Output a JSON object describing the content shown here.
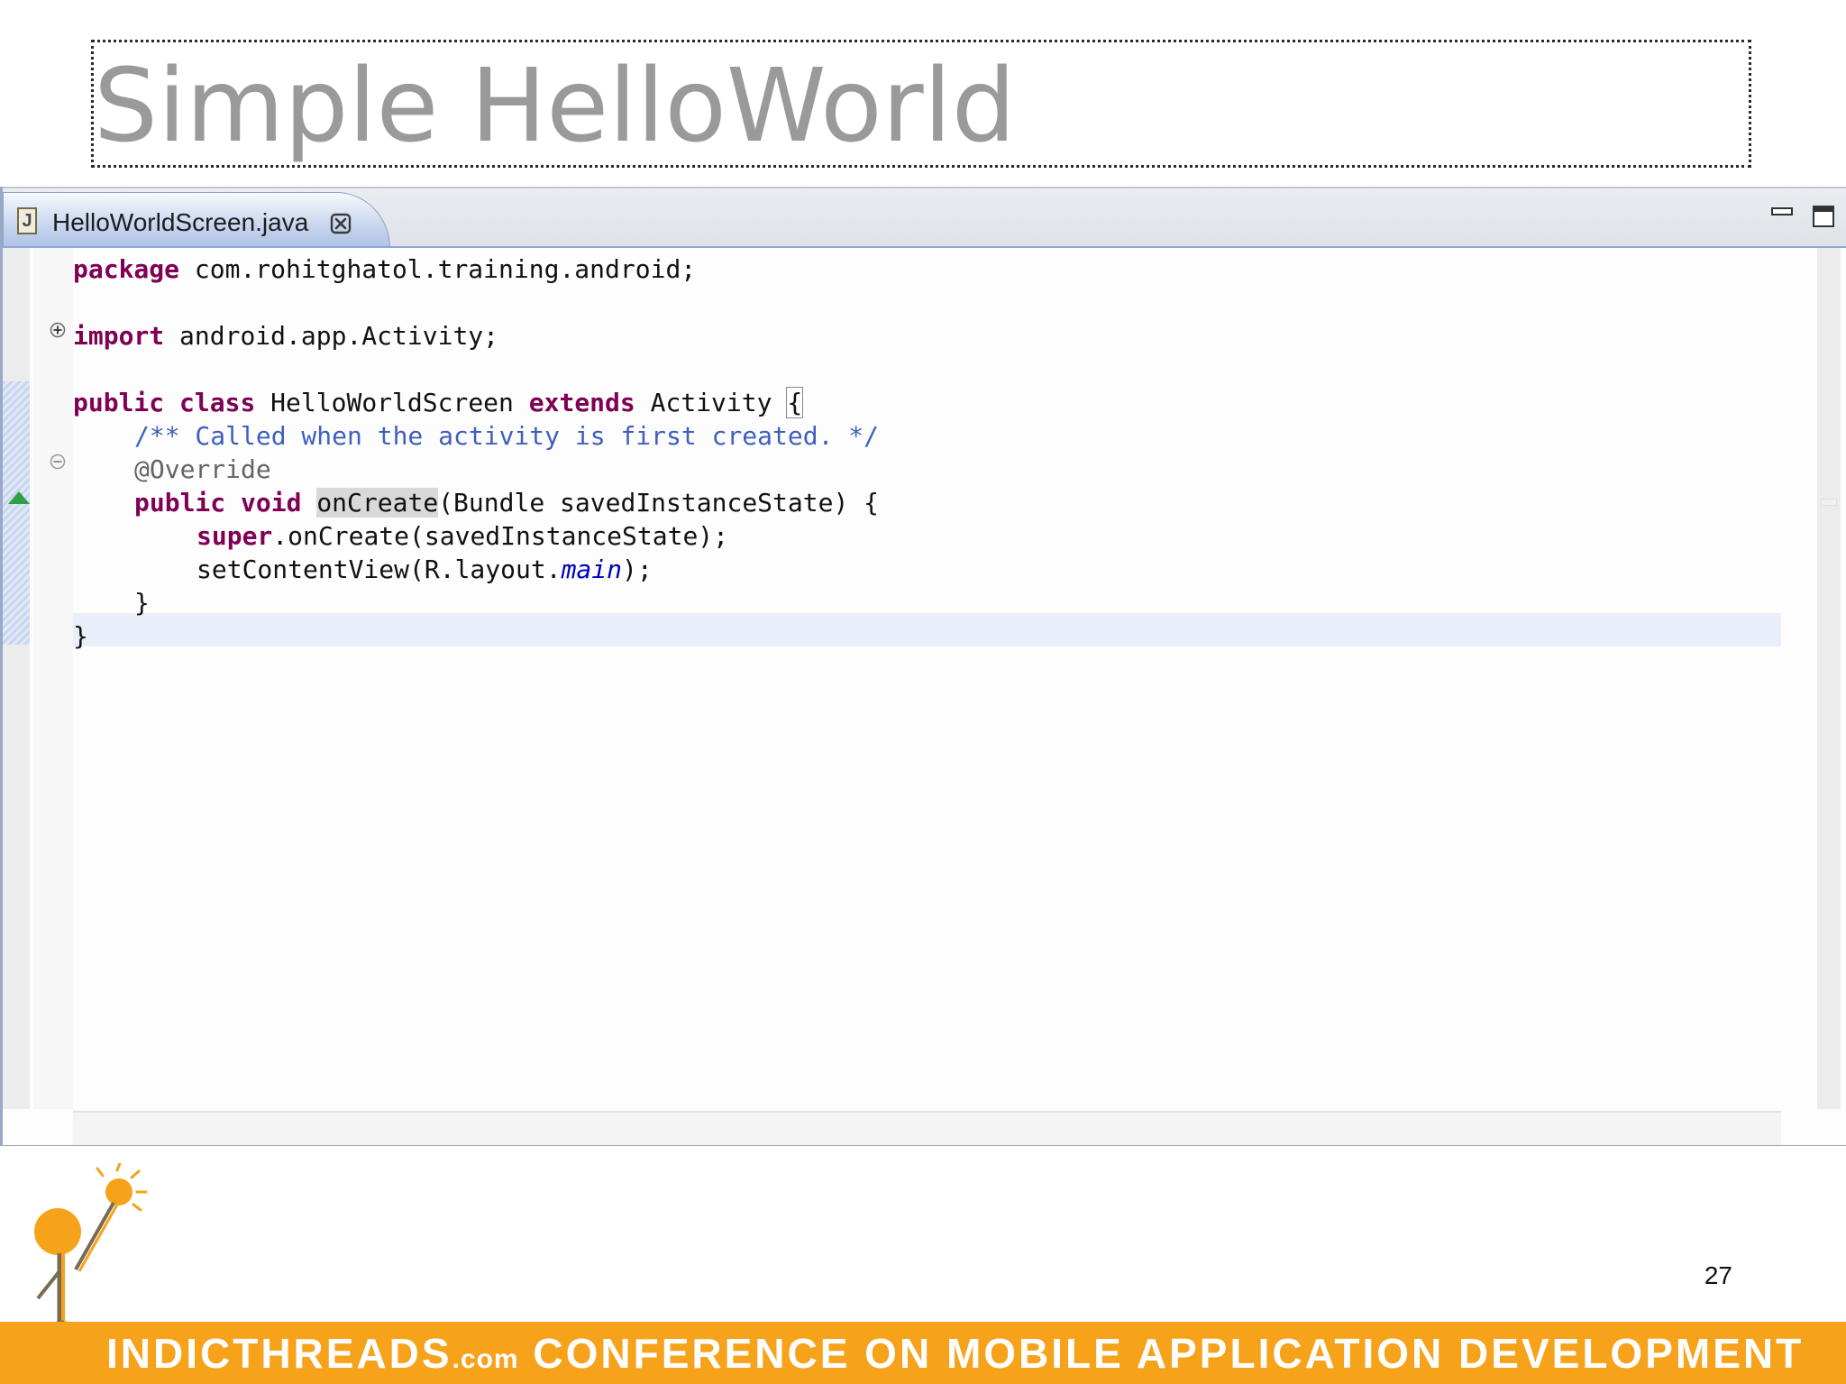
{
  "slide": {
    "title": "Simple HelloWorld",
    "page_number": "27"
  },
  "editor": {
    "tab_label": "HelloWorldScreen.java",
    "file_icon_letter": "J",
    "code": {
      "line1": {
        "kw": "package",
        "rest": " com.rohitghatol.training.android;"
      },
      "line3": {
        "kw": "import",
        "rest": " android.app.Activity;"
      },
      "line5": {
        "kw1": "public",
        "sp1": " ",
        "kw2": "class",
        "mid": " HelloWorldScreen ",
        "kw3": "extends",
        "rest": " Activity ",
        "brace": "{"
      },
      "line6": {
        "comment": "/** Called when the activity is first created. */"
      },
      "line7": {
        "annotation": "@Override"
      },
      "line8": {
        "kw1": "public",
        "sp1": " ",
        "kw2": "void",
        "sp2": " ",
        "method": "onCreate",
        "rest": "(Bundle savedInstanceState) {"
      },
      "line9": {
        "kw": "super",
        "rest": ".onCreate(savedInstanceState);"
      },
      "line10": {
        "pre": "setContentView(R.layout.",
        "field": "main",
        "post": ");"
      },
      "line11": {
        "text": "}"
      },
      "line12": {
        "text": "}"
      }
    }
  },
  "footer": {
    "part1": "INDICTHREADS",
    "domain": ".com",
    "part2": " CONFERENCE ON MOBILE APPLICATION DEVELOPMENT",
    "color": "#f7a21b"
  },
  "colors": {
    "keyword": "#7f0055",
    "comment": "#3f5fbf",
    "annotation": "#646464",
    "title": "#9a9a9a",
    "tab_active": "#aec2e6"
  },
  "icons": {
    "tab_close": "close-icon",
    "minimize": "minimize-icon",
    "maximize": "maximize-icon",
    "fold_expand": "plus-circle-icon",
    "fold_collapse": "minus-circle-icon",
    "warning": "warning-triangle-icon"
  }
}
